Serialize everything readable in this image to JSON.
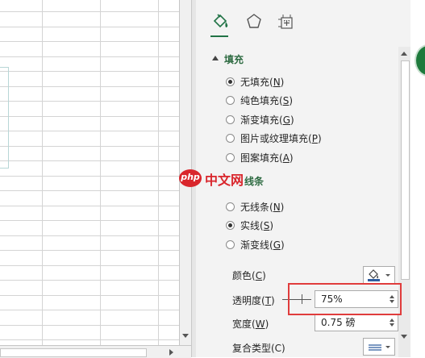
{
  "fill_section": {
    "title": "填充",
    "options": [
      {
        "text": "无填充(",
        "key": "N",
        "end": ")",
        "checked": true
      },
      {
        "text": "纯色填充(",
        "key": "S",
        "end": ")",
        "checked": false
      },
      {
        "text": "渐变填充(",
        "key": "G",
        "end": ")",
        "checked": false
      },
      {
        "text": "图片或纹理填充(",
        "key": "P",
        "end": ")",
        "checked": false
      },
      {
        "text": "图案填充(",
        "key": "A",
        "end": ")",
        "checked": false
      }
    ]
  },
  "line_section": {
    "title": "线条",
    "options": [
      {
        "text": "无线条(",
        "key": "N",
        "end": ")",
        "checked": false
      },
      {
        "text": "实线(",
        "key": "S",
        "end": ")",
        "checked": true
      },
      {
        "text": "渐变线(",
        "key": "G",
        "end": ")",
        "checked": false
      }
    ]
  },
  "properties": {
    "color_label": "颜色(",
    "color_key": "C",
    "color_end": ")",
    "transparency_label": "透明度(",
    "transparency_key": "T",
    "transparency_end": ")",
    "transparency_value": "75%",
    "width_label": "宽度(",
    "width_key": "W",
    "width_end": ")",
    "width_value": "0.75 磅",
    "compound_label": "复合类型(C)"
  },
  "watermark": {
    "logo": "php",
    "text": "中文网"
  },
  "colors": {
    "accent_green": "#217346",
    "highlight_red": "#e03c3c"
  },
  "icons": [
    "fill-line-icon",
    "effects-icon",
    "size-properties-icon"
  ]
}
